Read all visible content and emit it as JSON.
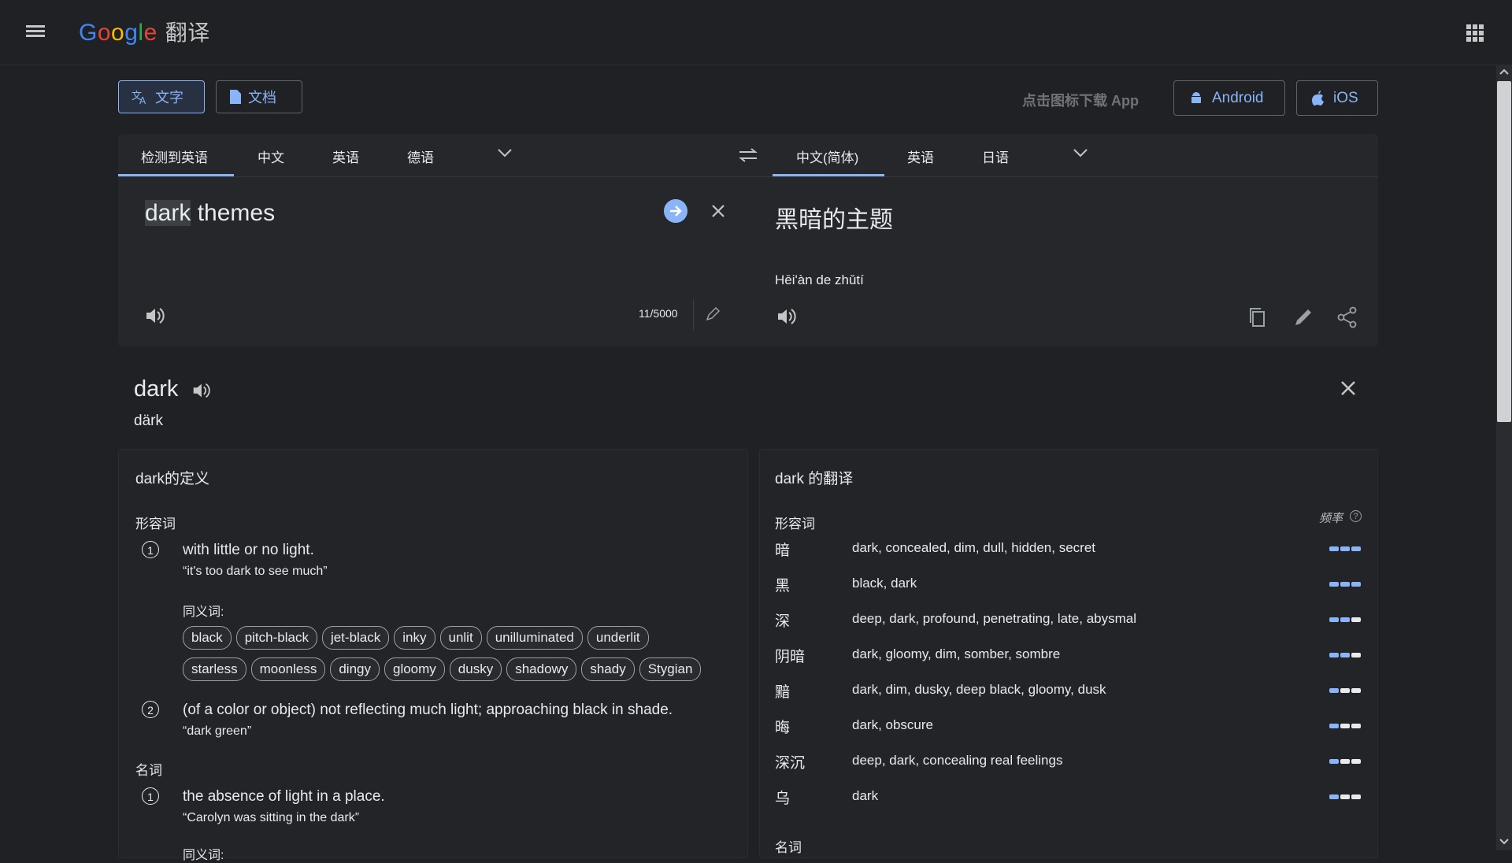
{
  "header": {
    "logo_letters": [
      "G",
      "o",
      "o",
      "g",
      "l",
      "e"
    ],
    "product": "翻译"
  },
  "modes": {
    "text": "文字",
    "document": "文档"
  },
  "app_download": {
    "label": "点击图标下载 App",
    "android": "Android",
    "ios": "iOS"
  },
  "source_langs": {
    "detected": "检测到英语",
    "l1": "中文",
    "l2": "英语",
    "l3": "德语"
  },
  "target_langs": {
    "selected": "中文(简体)",
    "l1": "英语",
    "l2": "日语"
  },
  "source": {
    "highlight": "dark",
    "rest": " themes",
    "char_count": "11/5000"
  },
  "target": {
    "text": "黑暗的主题",
    "pinyin": "Hēi'àn de zhǔtí"
  },
  "word": {
    "headword": "dark",
    "phonetic": "därk"
  },
  "definitions": {
    "title": "dark的定义",
    "pos_adj": "形容词",
    "def1": {
      "num": "1",
      "text": "with little or no light.",
      "example": "“it's too dark to see much”"
    },
    "synonyms_label": "同义词:",
    "synonyms_row1": [
      "black",
      "pitch-black",
      "jet-black",
      "inky",
      "unlit",
      "unilluminated",
      "underlit"
    ],
    "synonyms_row2": [
      "starless",
      "moonless",
      "dingy",
      "gloomy",
      "dusky",
      "shadowy",
      "shady",
      "Stygian"
    ],
    "def2": {
      "num": "2",
      "text": "(of a color or object) not reflecting much light; approaching black in shade.",
      "example": "“dark green”"
    },
    "pos_noun": "名词",
    "def3": {
      "num": "1",
      "text": "the absence of light in a place.",
      "example": "“Carolyn was sitting in the dark”"
    },
    "synonyms_label2": "同义词:"
  },
  "translations": {
    "title": "dark 的翻译",
    "pos_adj": "形容词",
    "freq_label": "频率",
    "help": "?",
    "rows": [
      {
        "word": "暗",
        "list": "dark, concealed, dim, dull, hidden, secret",
        "freq": 3
      },
      {
        "word": "黑",
        "list": "black, dark",
        "freq": 3
      },
      {
        "word": "深",
        "list": "deep, dark, profound, penetrating, late, abysmal",
        "freq": 2
      },
      {
        "word": "阴暗",
        "list": "dark, gloomy, dim, somber, sombre",
        "freq": 2
      },
      {
        "word": "黯",
        "list": "dark, dim, dusky, deep black, gloomy, dusk",
        "freq": 1
      },
      {
        "word": "晦",
        "list": "dark, obscure",
        "freq": 1
      },
      {
        "word": "深沉",
        "list": "deep, dark, concealing real feelings",
        "freq": 1
      },
      {
        "word": "乌",
        "list": "dark",
        "freq": 1
      }
    ],
    "pos_noun": "名词"
  },
  "colors": {
    "accent": "#8ab4f8",
    "background": "#202124"
  }
}
